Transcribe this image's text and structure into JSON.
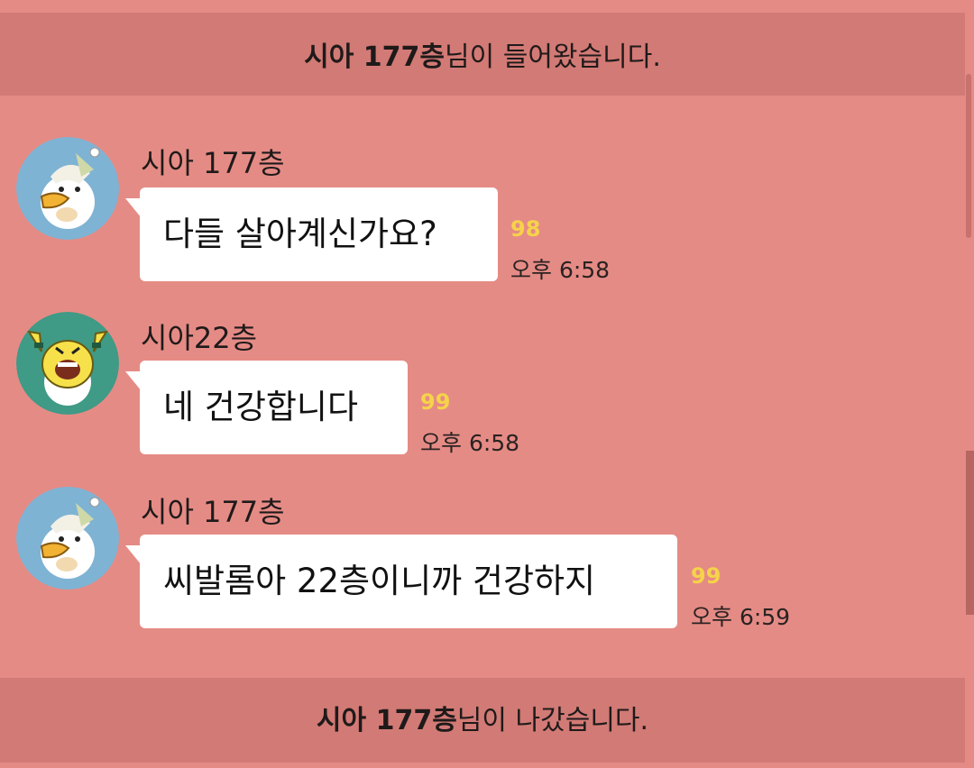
{
  "notices": {
    "enter": {
      "name": "시아 177층",
      "suffix": "님이 들어왔습니다."
    },
    "leave": {
      "name": "시아 177층",
      "suffix": "님이 나갔습니다."
    }
  },
  "messages": [
    {
      "sender": "시아 177층",
      "text": "다들 살아계신가요?",
      "unread": "98",
      "time": "오후 6:58",
      "avatar": "ryan-chick-icon"
    },
    {
      "sender": "시아22층",
      "text": "네 건강합니다",
      "unread": "99",
      "time": "오후 6:58",
      "avatar": "muzi-cheering-icon"
    },
    {
      "sender": "시아 177층",
      "text": "씨발롬아 22층이니까 건강하지",
      "unread": "99",
      "time": "오후 6:59",
      "avatar": "ryan-chick-icon"
    }
  ],
  "colors": {
    "background": "#e58b85",
    "notice_bar": "#d27a75",
    "unread": "#f5d34a",
    "bubble": "#ffffff"
  }
}
